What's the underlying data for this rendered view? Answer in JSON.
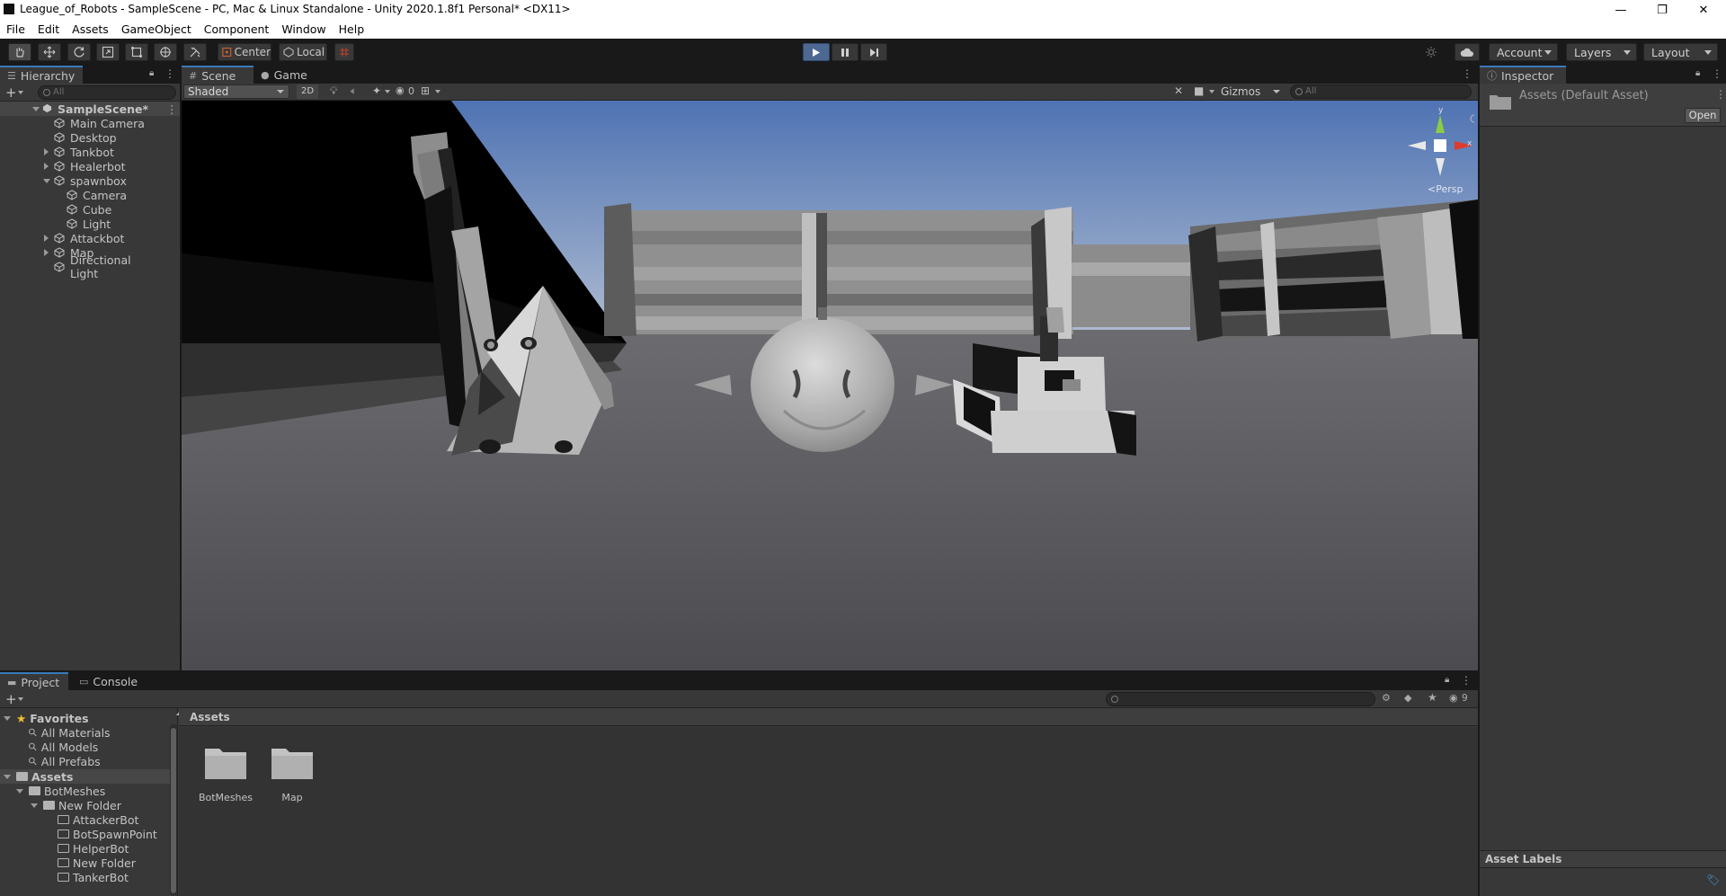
{
  "window": {
    "title": "League_of_Robots - SampleScene - PC, Mac & Linux Standalone - Unity 2020.1.8f1 Personal* <DX11>",
    "minimize_glyph": "—",
    "restore_glyph": "❐",
    "close_glyph": "✕"
  },
  "menu": [
    "File",
    "Edit",
    "Assets",
    "GameObject",
    "Component",
    "Window",
    "Help"
  ],
  "toolbar": {
    "pivot_label": "Center",
    "space_label": "Local",
    "account_label": "Account",
    "layers_label": "Layers",
    "layout_label": "Layout",
    "play_state": "playing"
  },
  "hierarchy": {
    "tab_label": "Hierarchy",
    "search_placeholder": "All",
    "scene_name": "SampleScene*",
    "items": [
      {
        "label": "Main Camera",
        "depth": 1,
        "expandable": false
      },
      {
        "label": "Desktop",
        "depth": 1,
        "expandable": false
      },
      {
        "label": "Tankbot",
        "depth": 1,
        "expandable": true,
        "expanded": false
      },
      {
        "label": "Healerbot",
        "depth": 1,
        "expandable": true,
        "expanded": false
      },
      {
        "label": "spawnbox",
        "depth": 1,
        "expandable": true,
        "expanded": true
      },
      {
        "label": "Camera",
        "depth": 2,
        "expandable": false
      },
      {
        "label": "Cube",
        "depth": 2,
        "expandable": false
      },
      {
        "label": "Light",
        "depth": 2,
        "expandable": false
      },
      {
        "label": "Attackbot",
        "depth": 1,
        "expandable": true,
        "expanded": false
      },
      {
        "label": "Map",
        "depth": 1,
        "expandable": true,
        "expanded": false
      },
      {
        "label": "Directional Light",
        "depth": 1,
        "expandable": false
      }
    ]
  },
  "scene_view": {
    "tab_scene": "Scene",
    "tab_game": "Game",
    "draw_mode": "Shaded",
    "mode_2d": "2D",
    "hidden_count": "0",
    "gizmos_label": "Gizmos",
    "search_placeholder": "All",
    "gizmo_axis_y": "y",
    "gizmo_axis_x": "x",
    "projection_label": "Persp"
  },
  "inspector": {
    "tab_label": "Inspector",
    "asset_title": "Assets (Default Asset)",
    "open_button": "Open",
    "labels_title": "Asset Labels"
  },
  "project": {
    "tab_project": "Project",
    "tab_console": "Console",
    "hidden_count": "9",
    "favorites_label": "Favorites",
    "favorites": [
      "All Materials",
      "All Models",
      "All Prefabs"
    ],
    "assets_root": "Assets",
    "tree": [
      {
        "label": "BotMeshes",
        "depth": 1,
        "expanded": true
      },
      {
        "label": "New Folder",
        "depth": 2,
        "expanded": true
      },
      {
        "label": "AttackerBot",
        "depth": 3
      },
      {
        "label": "BotSpawnPoint",
        "depth": 3
      },
      {
        "label": "HelperBot",
        "depth": 3
      },
      {
        "label": "New Folder",
        "depth": 3
      },
      {
        "label": "TankerBot",
        "depth": 3
      }
    ],
    "breadcrumb": "Assets",
    "grid_items": [
      "BotMeshes",
      "Map"
    ]
  },
  "colors": {
    "accent": "#3a79bb",
    "panel": "#383838",
    "bg": "#191919",
    "sky_top": "#5e82bf",
    "ground": "#5a5a5d"
  }
}
